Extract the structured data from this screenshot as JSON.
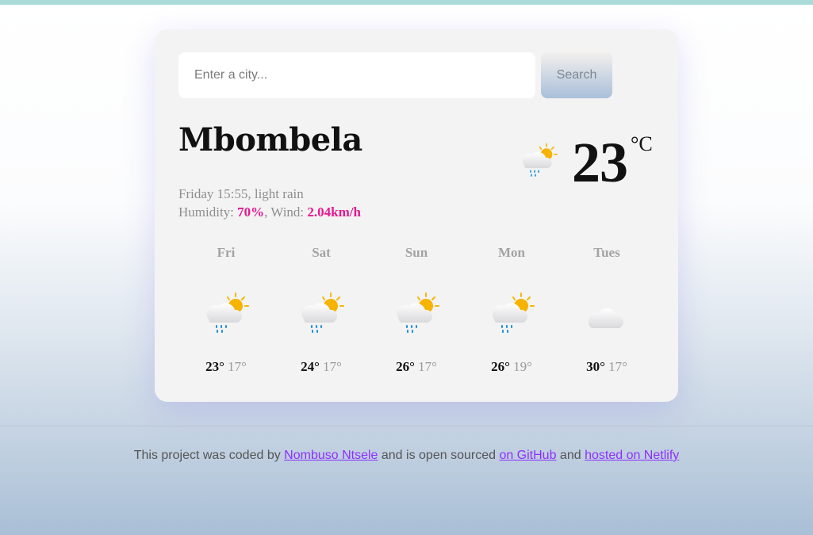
{
  "search": {
    "placeholder": "Enter a city...",
    "button_label": "Search"
  },
  "current": {
    "city": "Mbombela",
    "day_time_description": "Friday 15:55, light rain",
    "humidity_label": "Humidity: ",
    "humidity_value": "70%",
    "wind_label": ", Wind: ",
    "wind_value": "2.04km/h",
    "temperature": "23",
    "unit": "°C",
    "icon": "rain-sun-icon"
  },
  "forecast": [
    {
      "day": "Fri",
      "max": "23°",
      "min": "17°",
      "icon": "rain-sun-icon"
    },
    {
      "day": "Sat",
      "max": "24°",
      "min": "17°",
      "icon": "rain-sun-icon"
    },
    {
      "day": "Sun",
      "max": "26°",
      "min": "17°",
      "icon": "rain-sun-icon"
    },
    {
      "day": "Mon",
      "max": "26°",
      "min": "19°",
      "icon": "rain-sun-icon"
    },
    {
      "day": "Tues",
      "max": "30°",
      "min": "17°",
      "icon": "cloud-icon"
    }
  ],
  "footer": {
    "text1": "This project was coded by ",
    "author_link": "Nombuso Ntsele",
    "text2": " and is open sourced ",
    "github_link": "on GitHub",
    "text3": " and ",
    "netlify_link": "hosted on Netlify"
  },
  "colors": {
    "accent": "#e8188f",
    "link": "#8d2fff",
    "topbar": "#a9dbd9"
  }
}
